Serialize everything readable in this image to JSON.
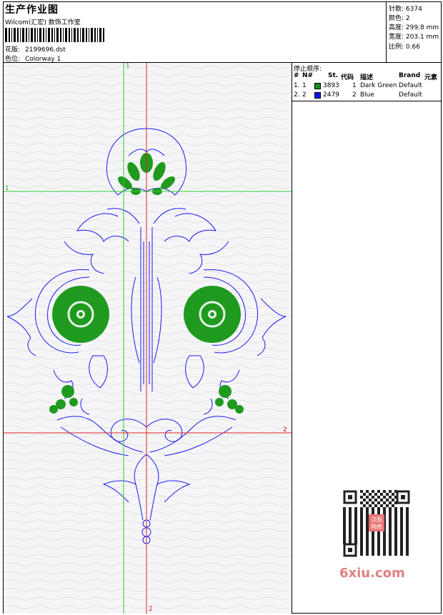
{
  "header": {
    "title": "生产作业图",
    "company": "Wilcom(汇宏) 数饰工作室",
    "design_label": "花版:",
    "design_value": "2199696.dst",
    "colorway_label": "色位:",
    "colorway_value": "Colorway 1"
  },
  "stats": {
    "stitches_label": "针数:",
    "stitches_value": "6374",
    "colors_label": "颜色:",
    "colors_value": "2",
    "height_label": "高度:",
    "height_value": "299.8 mm",
    "width_label": "宽度:",
    "width_value": "203.1 mm",
    "scale_label": "比例:",
    "scale_value": "0.66"
  },
  "stop_sequence": {
    "title": "停止顺序:",
    "headers": [
      "#",
      "N#",
      "St.",
      "代码",
      "描述",
      "Brand",
      "元素"
    ],
    "rows": [
      {
        "num": "1.",
        "n": "1",
        "color": "#1f8a1f",
        "stitches": "3893",
        "code": "1",
        "desc": "Dark Green",
        "brand": "Default"
      },
      {
        "num": "2.",
        "n": "2",
        "color": "#1010ee",
        "stitches": "2479",
        "code": "2",
        "desc": "Blue",
        "brand": "Default"
      }
    ]
  },
  "axes": {
    "green_v": "1",
    "green_h": "1",
    "red_v": "2",
    "red_h": "2"
  },
  "watermark": {
    "logo_text": "6xiu.com",
    "stamp_text": "汉图\n网络"
  },
  "colors": {
    "thread_green": "#1f9a1f",
    "thread_blue": "#1a1aee",
    "axis_green": "#33cc33",
    "axis_red": "#dd2222"
  }
}
